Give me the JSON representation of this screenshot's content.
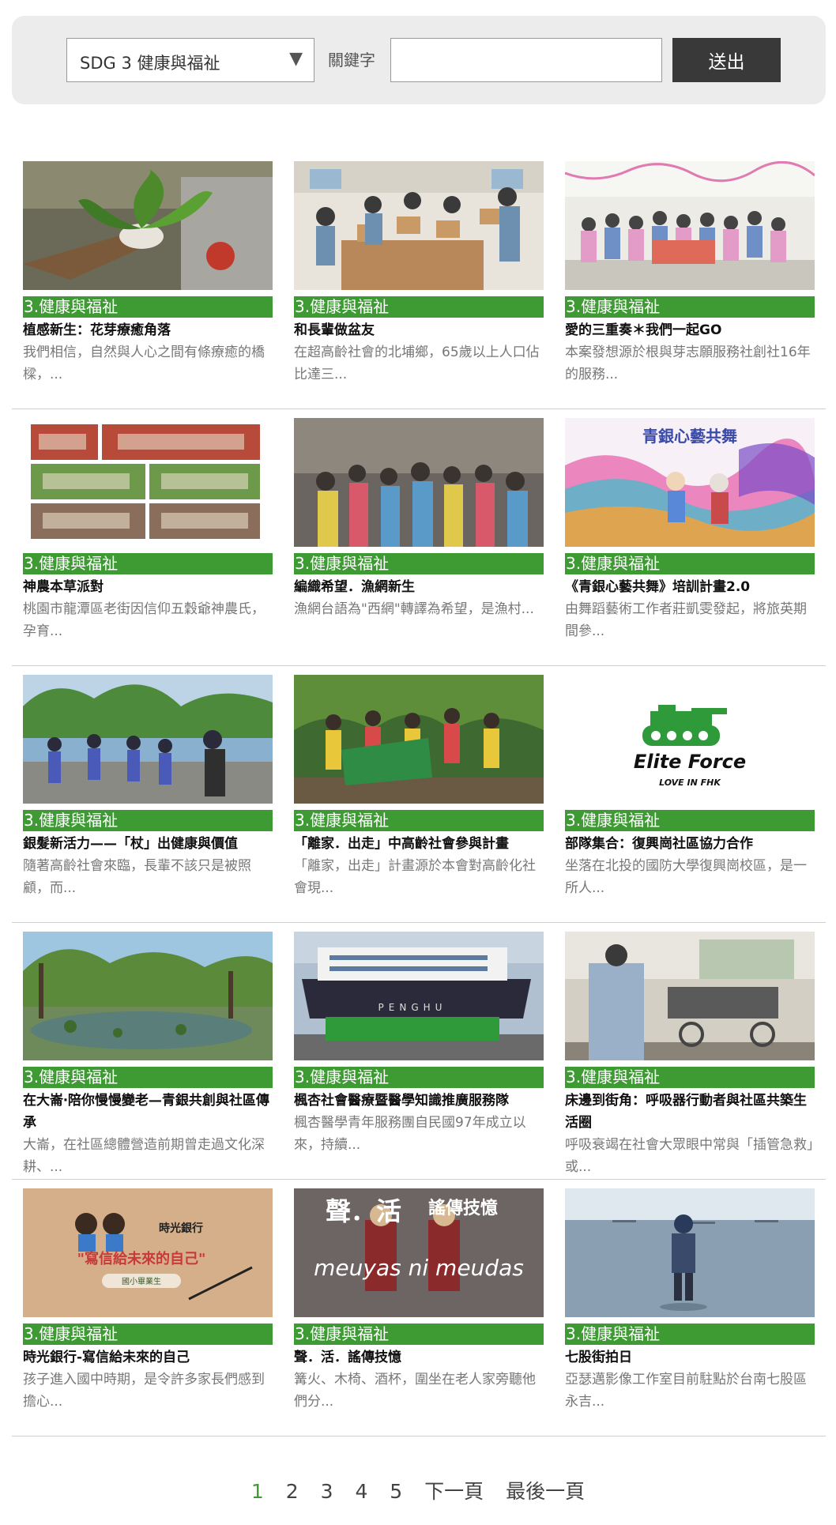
{
  "filter": {
    "sdg_selected": "SDG 3 健康與福祉",
    "keyword_label": "關鍵字",
    "keyword_value": "",
    "submit_label": "送出"
  },
  "cards": [
    {
      "category": "3.健康與福祉",
      "title": "植感新生：花芽療癒角落",
      "desc": "我們相信，自然與人心之間有條療癒的橋樑，..."
    },
    {
      "category": "3.健康與福祉",
      "title": "和長輩做盆友",
      "desc": "在超高齡社會的北埔鄉，65歲以上人口佔比達三..."
    },
    {
      "category": "3.健康與福祉",
      "title": "愛的三重奏＊我們一起GO",
      "desc": "本案發想源於根與芽志願服務社創社16年的服務..."
    },
    {
      "category": "3.健康與福祉",
      "title": "神農本草派對",
      "desc": "桃園市龍潭區老街因信仰五穀爺神農氏，孕育..."
    },
    {
      "category": "3.健康與福祉",
      "title": "編織希望．漁網新生",
      "desc": "漁網台語為\"西網\"轉譯為希望，是漁村..."
    },
    {
      "category": "3.健康與福祉",
      "title": "《青銀心藝共舞》培訓計畫2.0",
      "desc": "由舞蹈藝術工作者莊凱雯發起，將旅英期間參..."
    },
    {
      "category": "3.健康與福祉",
      "title": "銀髮新活力——「杖」出健康與價值",
      "desc": "隨著高齡社會來臨，長輩不該只是被照顧，而..."
    },
    {
      "category": "3.健康與福祉",
      "title": "「離家．出走」中高齡社會參與計畫",
      "desc": "「離家，出走」計畫源於本會對高齡化社會現..."
    },
    {
      "category": "3.健康與福祉",
      "title": "部隊集合：復興崗社區協力合作",
      "desc": "坐落在北投的國防大學復興崗校區，是一所人..."
    },
    {
      "category": "3.健康與福祉",
      "title": "在大崙‧陪你慢慢變老—青銀共創與社區傳承",
      "desc": "大崙，在社區總體營造前期曾走過文化深耕、..."
    },
    {
      "category": "3.健康與福祉",
      "title": "楓杏社會醫療暨醫學知識推廣服務隊",
      "desc": "楓杏醫學青年服務團自民國97年成立以來，持續..."
    },
    {
      "category": "3.健康與福祉",
      "title": "床邊到街角：呼吸器行動者與社區共築生活圈",
      "desc": "呼吸衰竭在社會大眾眼中常與「插管急救」或..."
    },
    {
      "category": "3.健康與福祉",
      "title": "時光銀行-寫信給未來的自己",
      "desc": "孩子進入國中時期，是令許多家長們感到擔心..."
    },
    {
      "category": "3.健康與福祉",
      "title": "聲．活．謠傳技憶",
      "desc": "篝火、木椅、酒杯，圍坐在老人家旁聽他們分..."
    },
    {
      "category": "3.健康與福祉",
      "title": "七股街拍日",
      "desc": "亞瑟邁影像工作室目前駐點於台南七股區永吉..."
    }
  ],
  "thumbs": {
    "dance_title": "青銀心藝共舞",
    "elite_line1": "Elite Force",
    "elite_line2": "LOVE IN FHK",
    "letter_bank": "時光銀行",
    "letter_main": "\"寫信給未來的自己\"",
    "letter_sub": "國小畢業生",
    "voice_title": "聲．活",
    "voice_title2": "謠傳技憶",
    "voice_script": "meuyas ni meudas",
    "ship_name": "PENGHU"
  },
  "pagination": {
    "pages": [
      "1",
      "2",
      "3",
      "4",
      "5"
    ],
    "current": "1",
    "next_label": "下一頁",
    "last_label": "最後一頁"
  },
  "colors": {
    "category_bg": "#3e9b34",
    "submit_bg": "#393939",
    "filter_bg": "#ececec"
  }
}
